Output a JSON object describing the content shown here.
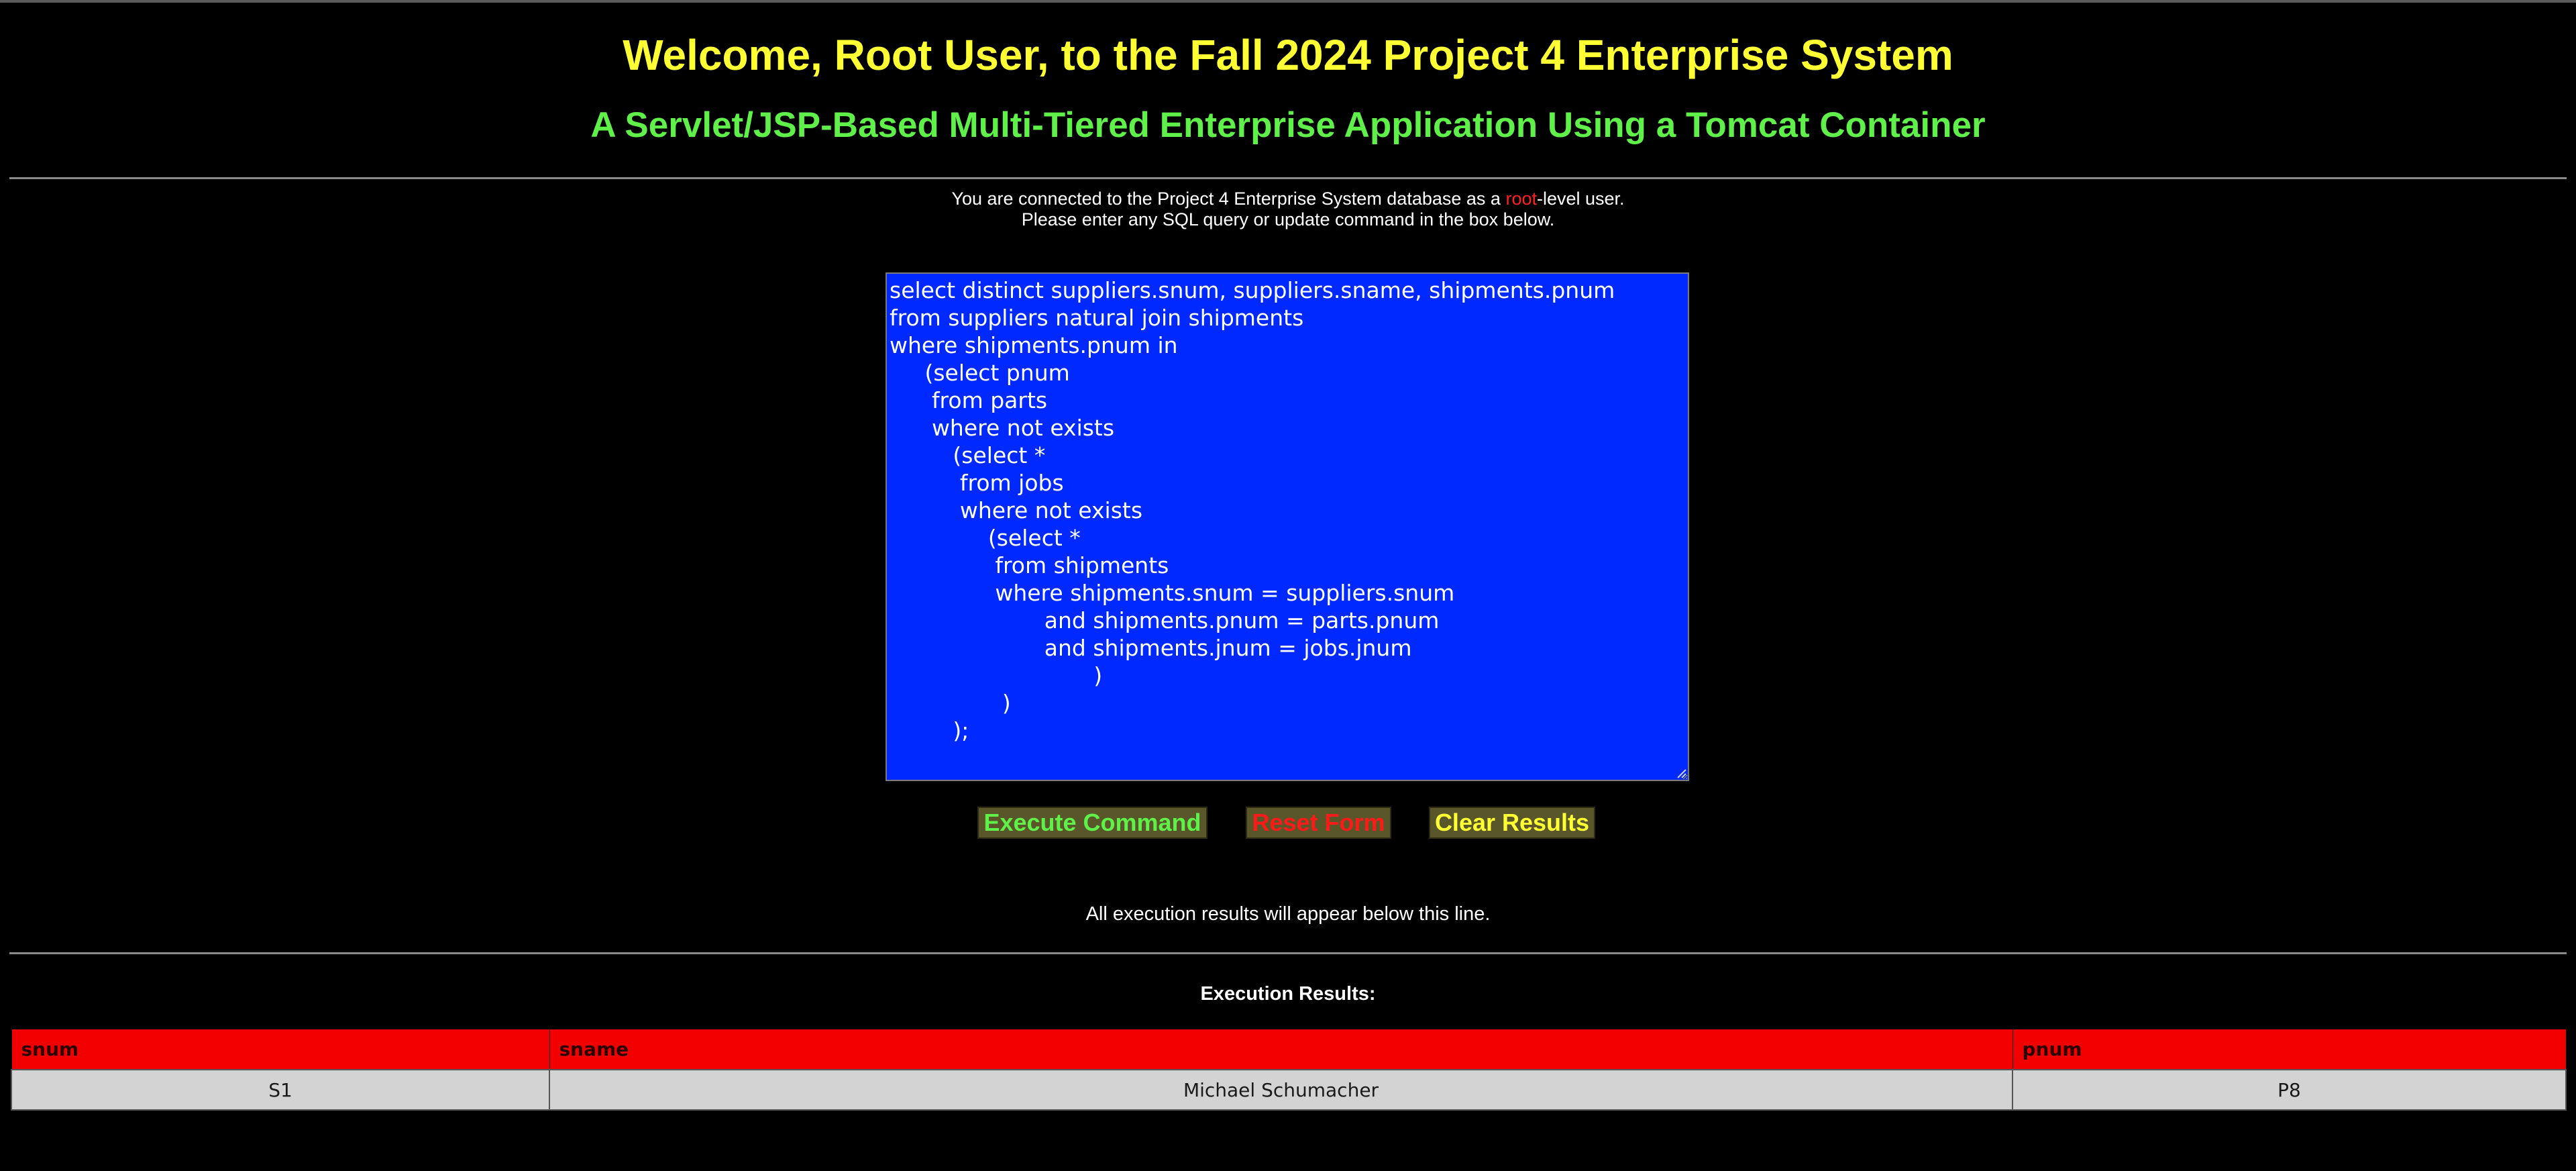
{
  "header": {
    "title": "Welcome, Root User, to the Fall 2024 Project 4 Enterprise System",
    "subtitle": "A Servlet/JSP-Based Multi-Tiered Enterprise Application Using a Tomcat Container"
  },
  "info": {
    "line1_prefix": "You are connected to the Project 4 Enterprise System database as a ",
    "role": "root",
    "line1_suffix": "-level user.",
    "line2": "Please enter any SQL query or update command in the box below."
  },
  "query": {
    "value": "select distinct suppliers.snum, suppliers.sname, shipments.pnum\nfrom suppliers natural join shipments\nwhere shipments.pnum in\n     (select pnum\n      from parts\n      where not exists\n         (select *\n          from jobs\n          where not exists\n              (select *\n               from shipments\n               where shipments.snum = suppliers.snum\n                      and shipments.pnum = parts.pnum\n                      and shipments.jnum = jobs.jnum\n                             )\n                )\n         );"
  },
  "buttons": {
    "execute": "Execute Command",
    "reset": "Reset Form",
    "clear": "Clear Results"
  },
  "results": {
    "note": "All execution results will appear below this line.",
    "heading": "Execution Results:",
    "columns": [
      "snum",
      "sname",
      "pnum"
    ],
    "rows": [
      [
        "S1",
        "Michael Schumacher",
        "P8"
      ]
    ]
  },
  "colors": {
    "background": "#000000",
    "title": "#ffff33",
    "subtitle": "#5ff04a",
    "query_background": "#0029ff",
    "header_row": "#f20000",
    "data_row": "#d3d3d3",
    "button_background": "#59562a"
  }
}
